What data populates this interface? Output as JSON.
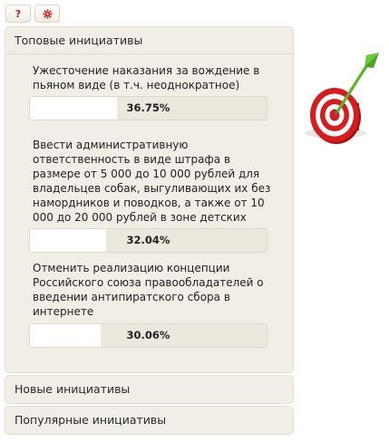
{
  "toolbar": {
    "help_label": "?",
    "settings_icon": "gear-icon"
  },
  "panels": {
    "top": {
      "title": "Топовые инициативы",
      "items": [
        {
          "text": "Ужесточение наказания за вождение в пьяном виде (в т.ч. неоднократное)",
          "percent_label": "36.75%",
          "fraction": 0.3675
        },
        {
          "text": "Ввести административную ответственность в виде штрафа в размере от 5 000 до 10 000 рублей для владельцев собак, выгуливающих их без намордников и поводков, а также от 10 000 до 20 000 рублей в зоне детских площадок",
          "percent_label": "32.04%",
          "fraction": 0.3204
        },
        {
          "text": "Отменить реализацию концепции Российского союза правообладателей о введении антипиратского сбора в интернете",
          "percent_label": "30.06%",
          "fraction": 0.3006
        }
      ]
    },
    "new": {
      "title": "Новые инициативы"
    },
    "popular": {
      "title": "Популярные инициативы"
    }
  },
  "decor": {
    "target_icon": "dart-target-icon",
    "colors": {
      "red": "#c81818",
      "green": "#5ab52a"
    }
  }
}
